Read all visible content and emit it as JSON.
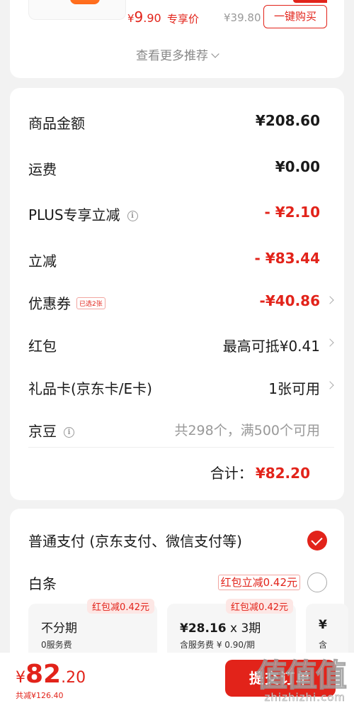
{
  "recommend": {
    "price_symbol": "¥",
    "price_int": "9",
    "price_dec": ".90",
    "exclusive_label": "专享价",
    "original_price": "¥39.80",
    "buy_button": "一键购买",
    "more_label": "查看更多推荐"
  },
  "summary": {
    "rows": [
      {
        "label": "商品金额",
        "value": "¥208.60"
      },
      {
        "label": "运费",
        "value": "¥0.00"
      },
      {
        "label": "PLUS专享立减",
        "value": "- ¥2.10"
      },
      {
        "label": "立减",
        "value": "- ¥83.44"
      },
      {
        "label": "优惠券",
        "badge": "已选2张",
        "value": "-¥40.86"
      },
      {
        "label": "红包",
        "value": "最高可抵¥0.41"
      },
      {
        "label": "礼品卡(京东卡/E卡)",
        "value": "1张可用"
      },
      {
        "label": "京豆",
        "value": "共298个，满500个可用"
      }
    ],
    "total_label": "合计：",
    "total_value": "¥82.20"
  },
  "payment": {
    "normal_label": "普通支付 (京东支付、微信支付等)",
    "baitiao_label": "白条",
    "baitiao_badge": "红包立减0.42元",
    "plans": [
      {
        "badge": "红包减0.42元",
        "title": "不分期",
        "sub": "0服务费"
      },
      {
        "badge": "红包减0.42元",
        "title_amount": "¥28.16",
        "title_times": " x 3期",
        "sub": "含服务费 ¥ 0.90/期"
      },
      {
        "title_amount": "¥",
        "sub": "含"
      }
    ]
  },
  "bottom": {
    "price_symbol": "¥",
    "price_int": "82",
    "price_dec": ".20",
    "saved": "共减¥126.40",
    "submit_label": "提交订单"
  },
  "watermark": {
    "text": "值值值",
    "url": "zhizhizhi.com"
  },
  "colors": {
    "accent": "#e2231a",
    "background": "#f2f2f2"
  }
}
